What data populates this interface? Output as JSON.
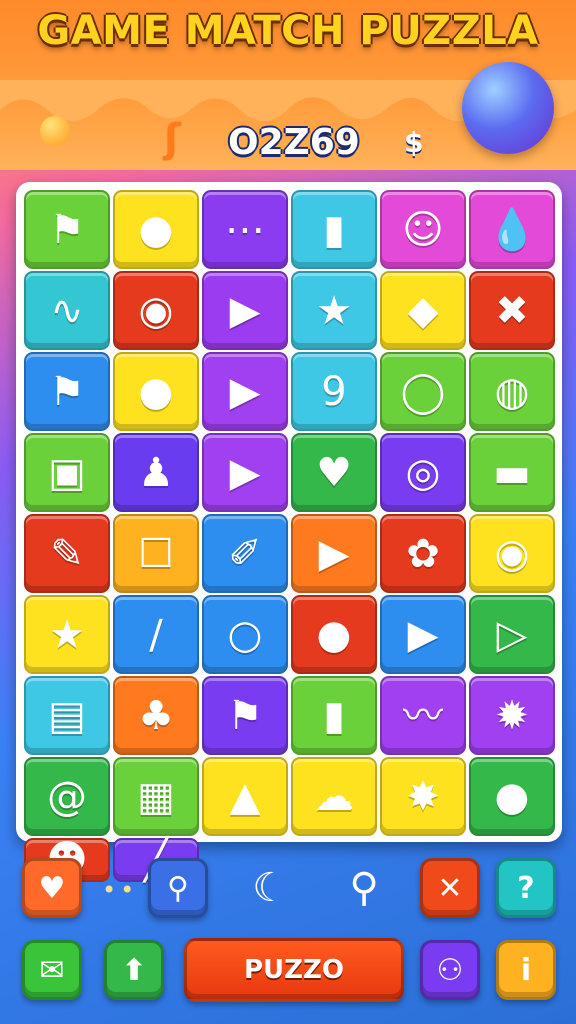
{
  "header": {
    "title": "GAME MATCH PUZZLA",
    "score": "O2Z69",
    "currency_symbol": "$"
  },
  "board": {
    "tiles": [
      {
        "name": "flag-tile",
        "icon": "⚑",
        "color": "#6ad13a"
      },
      {
        "name": "speech-bubble-tile",
        "icon": "●",
        "color": "#ffe21f"
      },
      {
        "name": "chat-bubble-tile",
        "icon": "⋯",
        "color": "#8b3cf0"
      },
      {
        "name": "bottle-tile",
        "icon": "▮",
        "color": "#3ec8e6"
      },
      {
        "name": "grandma-face-tile",
        "icon": "☺",
        "color": "#e34ad8"
      },
      {
        "name": "drop-tile",
        "icon": "💧",
        "color": "#e34ad8"
      },
      {
        "name": "snake-tile",
        "icon": "∿",
        "color": "#34c6d2"
      },
      {
        "name": "fox-face-tile",
        "icon": "◉",
        "color": "#e53a1e"
      },
      {
        "name": "play-triangle-tile",
        "icon": "▶",
        "color": "#9b3cf0"
      },
      {
        "name": "star-tile",
        "icon": "★",
        "color": "#3ec8e6"
      },
      {
        "name": "red-gem-tile",
        "icon": "◆",
        "color": "#ffe21f"
      },
      {
        "name": "cross-tile",
        "icon": "✖",
        "color": "#e53a1e"
      },
      {
        "name": "red-flag-tile",
        "icon": "⚑",
        "color": "#2e8ef0"
      },
      {
        "name": "balloon-tile",
        "icon": "●",
        "color": "#ffe21f"
      },
      {
        "name": "play-button-tile",
        "icon": "▶",
        "color": "#a040f0"
      },
      {
        "name": "number-nine-tile",
        "icon": "9",
        "color": "#3ec8e6"
      },
      {
        "name": "lightbulb-tile",
        "icon": "◯",
        "color": "#6ad13a"
      },
      {
        "name": "sphere-tile",
        "icon": "◍",
        "color": "#6ad13a"
      },
      {
        "name": "monster-box-tile",
        "icon": "▣",
        "color": "#6ad13a"
      },
      {
        "name": "pacifier-tile",
        "icon": "♟",
        "color": "#6a3cf0"
      },
      {
        "name": "blue-triangle-tile",
        "icon": "▶",
        "color": "#a040f0"
      },
      {
        "name": "heart-card-tile",
        "icon": "♥",
        "color": "#34b84a"
      },
      {
        "name": "donut-tile",
        "icon": "◎",
        "color": "#7a3cf0"
      },
      {
        "name": "green-tube-tile",
        "icon": "▬",
        "color": "#6ad13a"
      },
      {
        "name": "pencil-tile",
        "icon": "✎",
        "color": "#e53a1e"
      },
      {
        "name": "box-face-tile",
        "icon": "☐",
        "color": "#ffb21f"
      },
      {
        "name": "pen-tile",
        "icon": "✐",
        "color": "#2e8ef0"
      },
      {
        "name": "orange-triangle-tile",
        "icon": "▶",
        "color": "#ff7a1f"
      },
      {
        "name": "paw-tile",
        "icon": "✿",
        "color": "#e53a1e"
      },
      {
        "name": "blue-ring-tile",
        "icon": "◉",
        "color": "#ffe21f"
      },
      {
        "name": "gold-star-tile",
        "icon": "★",
        "color": "#ffe21f"
      },
      {
        "name": "needle-tile",
        "icon": "∕",
        "color": "#2e8ef0"
      },
      {
        "name": "ring-tile",
        "icon": "○",
        "color": "#2e8ef0"
      },
      {
        "name": "chat-cookie-tile",
        "icon": "●",
        "color": "#e53a1e"
      },
      {
        "name": "rainbow-arrow-tile",
        "icon": "▶",
        "color": "#2e8ef0"
      },
      {
        "name": "video-play-tile",
        "icon": "▷",
        "color": "#34b84a"
      },
      {
        "name": "pink-bag-tile",
        "icon": "▤",
        "color": "#3ec8e6"
      },
      {
        "name": "palm-tree-tile",
        "icon": "♣",
        "color": "#ff7a1f"
      },
      {
        "name": "us-flag-tile",
        "icon": "⚑",
        "color": "#7a3cf0"
      },
      {
        "name": "battery-tile",
        "icon": "▮",
        "color": "#6ad13a"
      },
      {
        "name": "lizard-tile",
        "icon": "〰",
        "color": "#a040f0"
      },
      {
        "name": "splash-tile",
        "icon": "✹",
        "color": "#a040f0"
      },
      {
        "name": "spiral-tile",
        "icon": "@",
        "color": "#34b84a"
      },
      {
        "name": "easel-tile",
        "icon": "▦",
        "color": "#6ad13a"
      },
      {
        "name": "fox-tile",
        "icon": "▲",
        "color": "#ffe21f"
      },
      {
        "name": "cloud-tile",
        "icon": "☁",
        "color": "#ffe21f"
      },
      {
        "name": "sun-tile",
        "icon": "✸",
        "color": "#ffe21f"
      },
      {
        "name": "orange-fruit-tile",
        "icon": "●",
        "color": "#34b84a"
      },
      {
        "name": "red-mushroom-tile",
        "icon": "☻",
        "color": "#e53a1e"
      },
      {
        "name": "carrot-tile",
        "icon": "╱",
        "color": "#7a3cf0"
      }
    ]
  },
  "toolbar": {
    "puzzo_label": "PUZZO",
    "dots": "••",
    "buttons": [
      {
        "name": "heart-button",
        "icon": "♥",
        "color": "#ff6a2a"
      },
      {
        "name": "flashlight-button",
        "icon": "⚲",
        "color": "#3a6fe6"
      },
      {
        "name": "moon-shape-button",
        "icon": "☾",
        "color": ""
      },
      {
        "name": "magnifier-button",
        "icon": "⚲",
        "color": ""
      },
      {
        "name": "close-button",
        "icon": "✕",
        "color": "#f04a1a"
      },
      {
        "name": "help-button",
        "icon": "?",
        "color": "#22c4c4"
      },
      {
        "name": "message-button",
        "icon": "✉",
        "color": "#3ac43a"
      },
      {
        "name": "arrow-button",
        "icon": "⬆",
        "color": "#34b84a"
      },
      {
        "name": "user-button",
        "icon": "⚇",
        "color": "#7a3cf0"
      },
      {
        "name": "info-button",
        "icon": "i",
        "color": "#ffb21f"
      }
    ]
  }
}
